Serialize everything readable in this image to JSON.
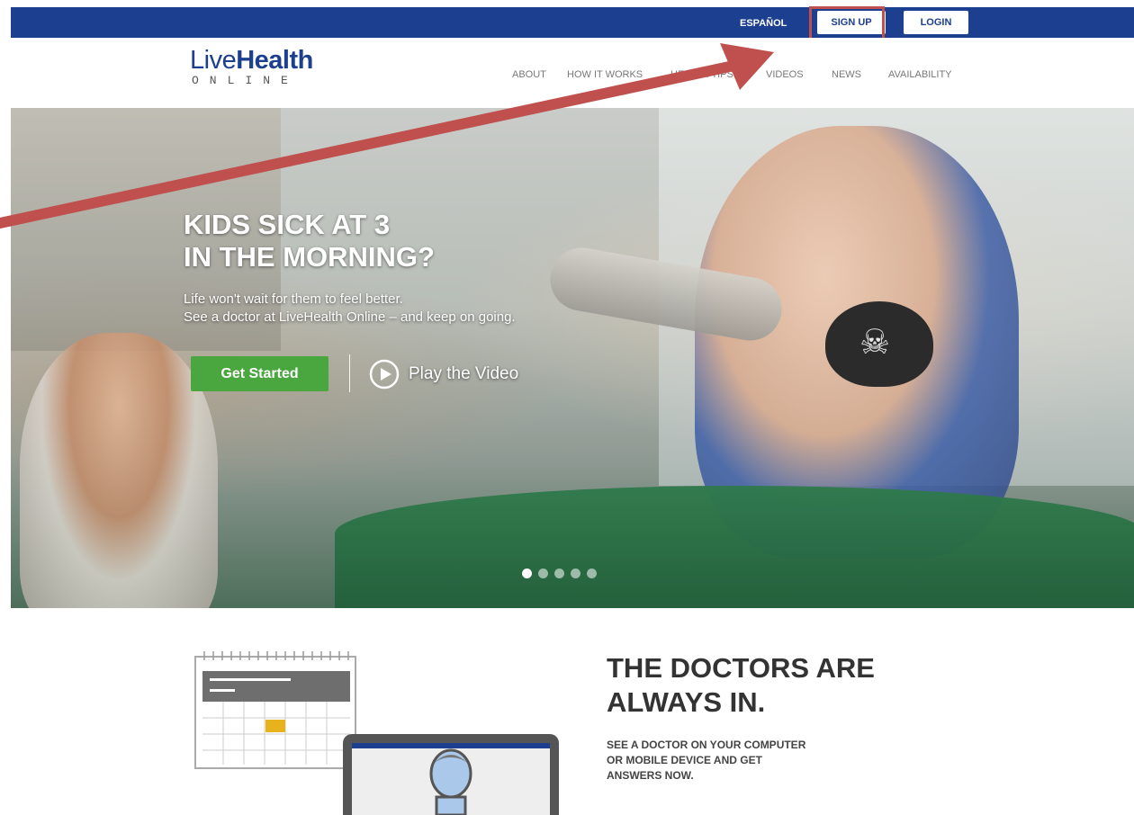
{
  "topbar": {
    "espanol": "ESPAÑOL",
    "signup": "SIGN UP",
    "login": "LOGIN"
  },
  "logo": {
    "live": "Live",
    "health": "Health",
    "online": "ONLINE"
  },
  "nav": {
    "items": [
      "ABOUT",
      "HOW IT WORKS",
      "HEALTH TIPS",
      "VIDEOS",
      "NEWS",
      "AVAILABILITY"
    ]
  },
  "hero": {
    "title_line1": "KIDS SICK AT 3",
    "title_line2": "IN THE MORNING?",
    "sub_line1": "Life won't wait for them to feel better.",
    "sub_line2": "See a doctor at LiveHealth Online – and keep on going.",
    "cta": "Get Started",
    "video": "Play the Video",
    "slides_total": 5,
    "slide_active": 1
  },
  "section": {
    "title_line1": "THE DOCTORS ARE",
    "title_line2": "ALWAYS IN.",
    "sub_line1": "SEE A DOCTOR ON YOUR COMPUTER",
    "sub_line2": "OR MOBILE DEVICE AND GET",
    "sub_line3": "ANSWERS NOW."
  },
  "colors": {
    "brand_blue": "#1d3f8f",
    "cta_green": "#4aa63f",
    "annotation_red": "#c0504d"
  },
  "icons": {
    "play": "play-circle-icon",
    "calendar": "calendar-icon",
    "doctor": "doctor-on-screen-icon"
  }
}
